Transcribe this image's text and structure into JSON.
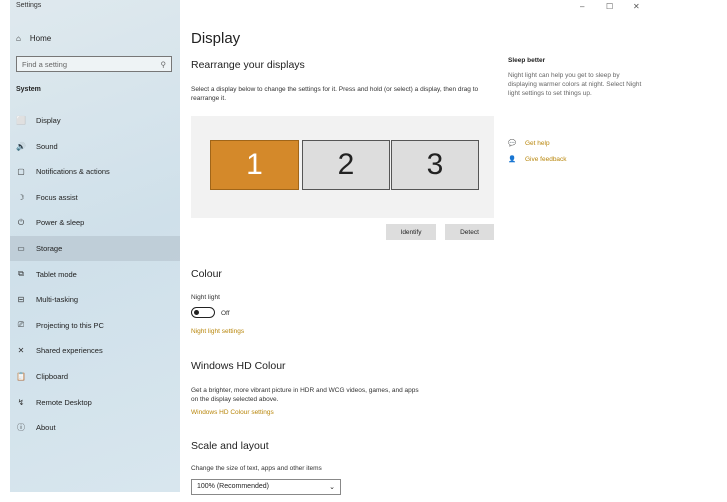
{
  "window": {
    "title": "Settings",
    "minimize": "–",
    "maximize": "☐",
    "close": "✕"
  },
  "sidebar": {
    "home": "Home",
    "search_placeholder": "Find a setting",
    "section": "System",
    "items": [
      {
        "icon": "⬜",
        "label": "Display"
      },
      {
        "icon": "🔊",
        "label": "Sound"
      },
      {
        "icon": "▢",
        "label": "Notifications & actions"
      },
      {
        "icon": "☽",
        "label": "Focus assist"
      },
      {
        "icon": "⏻",
        "label": "Power & sleep"
      },
      {
        "icon": "▭",
        "label": "Storage"
      },
      {
        "icon": "⧉",
        "label": "Tablet mode"
      },
      {
        "icon": "⊟",
        "label": "Multi-tasking"
      },
      {
        "icon": "⎚",
        "label": "Projecting to this PC"
      },
      {
        "icon": "✕",
        "label": "Shared experiences"
      },
      {
        "icon": "📋",
        "label": "Clipboard"
      },
      {
        "icon": "↯",
        "label": "Remote Desktop"
      },
      {
        "icon": "ⓘ",
        "label": "About"
      }
    ],
    "selected_index": 5
  },
  "main": {
    "title": "Display",
    "rearrange_title": "Rearrange your displays",
    "rearrange_desc": "Select a display below to change the settings for it. Press and hold (or select) a display, then drag to rearrange it.",
    "monitors": [
      "1",
      "2",
      "3"
    ],
    "identify": "Identify",
    "detect": "Detect",
    "colour_title": "Colour",
    "night_light_label": "Night light",
    "night_light_state": "Off",
    "night_light_link": "Night light settings",
    "hd_title": "Windows HD Colour",
    "hd_desc": "Get a brighter, more vibrant picture in HDR and WCG videos, games, and apps on the display selected above.",
    "hd_link": "Windows HD Colour settings",
    "scale_title": "Scale and layout",
    "scale_label": "Change the size of text, apps and other items",
    "scale_value": "100% (Recommended)"
  },
  "aside": {
    "title": "Sleep better",
    "desc": "Night light can help you get to sleep by displaying warmer colors at night. Select Night light settings to set things up.",
    "get_help": "Get help",
    "feedback": "Give feedback"
  },
  "colors": {
    "accent": "#d4892a",
    "link": "#b8860b"
  }
}
